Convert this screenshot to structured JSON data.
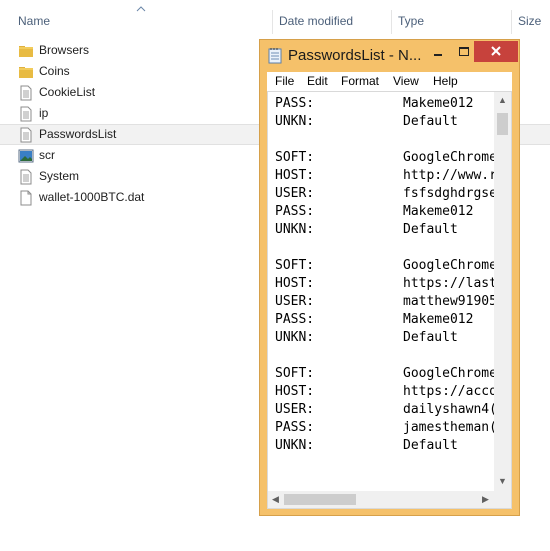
{
  "explorer": {
    "columns": {
      "name": "Name",
      "date_modified": "Date modified",
      "type": "Type",
      "size": "Size"
    },
    "files": [
      {
        "name": "Browsers",
        "icon": "folder-icon"
      },
      {
        "name": "Coins",
        "icon": "folder-icon"
      },
      {
        "name": "CookieList",
        "icon": "text-file-icon"
      },
      {
        "name": "ip",
        "icon": "text-file-icon"
      },
      {
        "name": "PasswordsList",
        "icon": "text-file-icon",
        "selected": true
      },
      {
        "name": "scr",
        "icon": "image-file-icon"
      },
      {
        "name": "System",
        "icon": "text-file-icon"
      },
      {
        "name": "wallet-1000BTC.dat",
        "icon": "blank-file-icon"
      }
    ]
  },
  "notepad": {
    "title": "PasswordsList - N...",
    "menu": [
      "File",
      "Edit",
      "Format",
      "View",
      "Help"
    ],
    "lines": [
      {
        "key": "PASS:",
        "value": "Makeme012"
      },
      {
        "key": "UNKN:",
        "value": "Default"
      },
      {
        "key": "",
        "value": ""
      },
      {
        "key": "SOFT:",
        "value": "GoogleChrome"
      },
      {
        "key": "HOST:",
        "value": "http://www.r"
      },
      {
        "key": "USER:",
        "value": "fsfsdghdrgse"
      },
      {
        "key": "PASS:",
        "value": "Makeme012"
      },
      {
        "key": "UNKN:",
        "value": "Default"
      },
      {
        "key": "",
        "value": ""
      },
      {
        "key": "SOFT:",
        "value": "GoogleChrome"
      },
      {
        "key": "HOST:",
        "value": "https://last"
      },
      {
        "key": "USER:",
        "value": "matthew91905"
      },
      {
        "key": "PASS:",
        "value": "Makeme012"
      },
      {
        "key": "UNKN:",
        "value": "Default"
      },
      {
        "key": "",
        "value": ""
      },
      {
        "key": "SOFT:",
        "value": "GoogleChrome"
      },
      {
        "key": "HOST:",
        "value": "https://acco"
      },
      {
        "key": "USER:",
        "value": "dailyshawn4("
      },
      {
        "key": "PASS:",
        "value": "jamestheman("
      },
      {
        "key": "UNKN:",
        "value": "Default"
      }
    ]
  },
  "colors": {
    "window_frame": "#f5c16a",
    "close_button": "#c7423c",
    "column_header_text": "#4c607a",
    "selected_row": "#f2f2f2"
  }
}
